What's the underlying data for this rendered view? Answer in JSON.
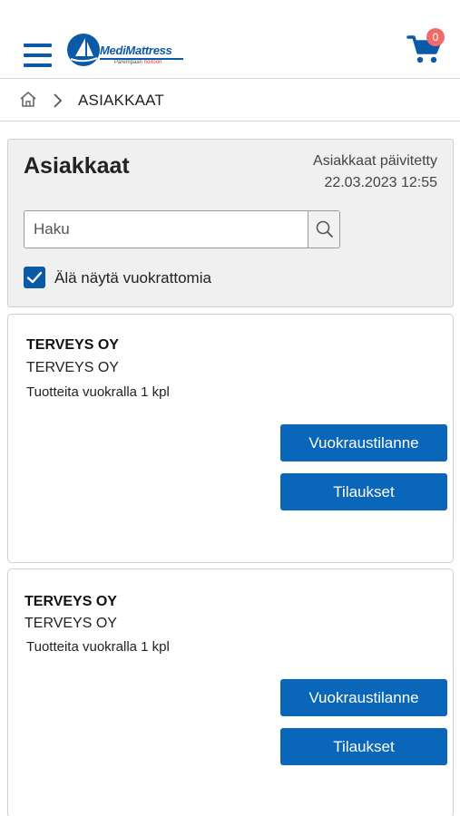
{
  "header": {
    "logo_name": "MediMattress",
    "logo_tagline_prefix": "Parempaan",
    "logo_tagline_highlight": "hoitoon",
    "cart_count": "0",
    "brand_color": "#0a5aa8",
    "badge_color": "#f06a6a"
  },
  "breadcrumb": {
    "current": "ASIAKKAAT"
  },
  "panel": {
    "title": "Asiakkaat",
    "updated_label": "Asiakkaat päivitetty",
    "updated_time": "22.03.2023 12:55",
    "search_placeholder": "Haku",
    "checkbox_label": "Älä näytä vuokrattomia",
    "checkbox_checked": true
  },
  "customers": [
    {
      "name": "TERVEYS OY",
      "sub": "TERVEYS OY",
      "rentals": "Tuotteita vuokralla 1 kpl",
      "rent_button": "Vuokraustilanne",
      "orders_button": "Tilaukset"
    },
    {
      "name": "TERVEYS OY",
      "sub": "TERVEYS OY",
      "rentals": "Tuotteita vuokralla 1 kpl",
      "rent_button": "Vuokraustilanne",
      "orders_button": "Tilaukset"
    }
  ]
}
